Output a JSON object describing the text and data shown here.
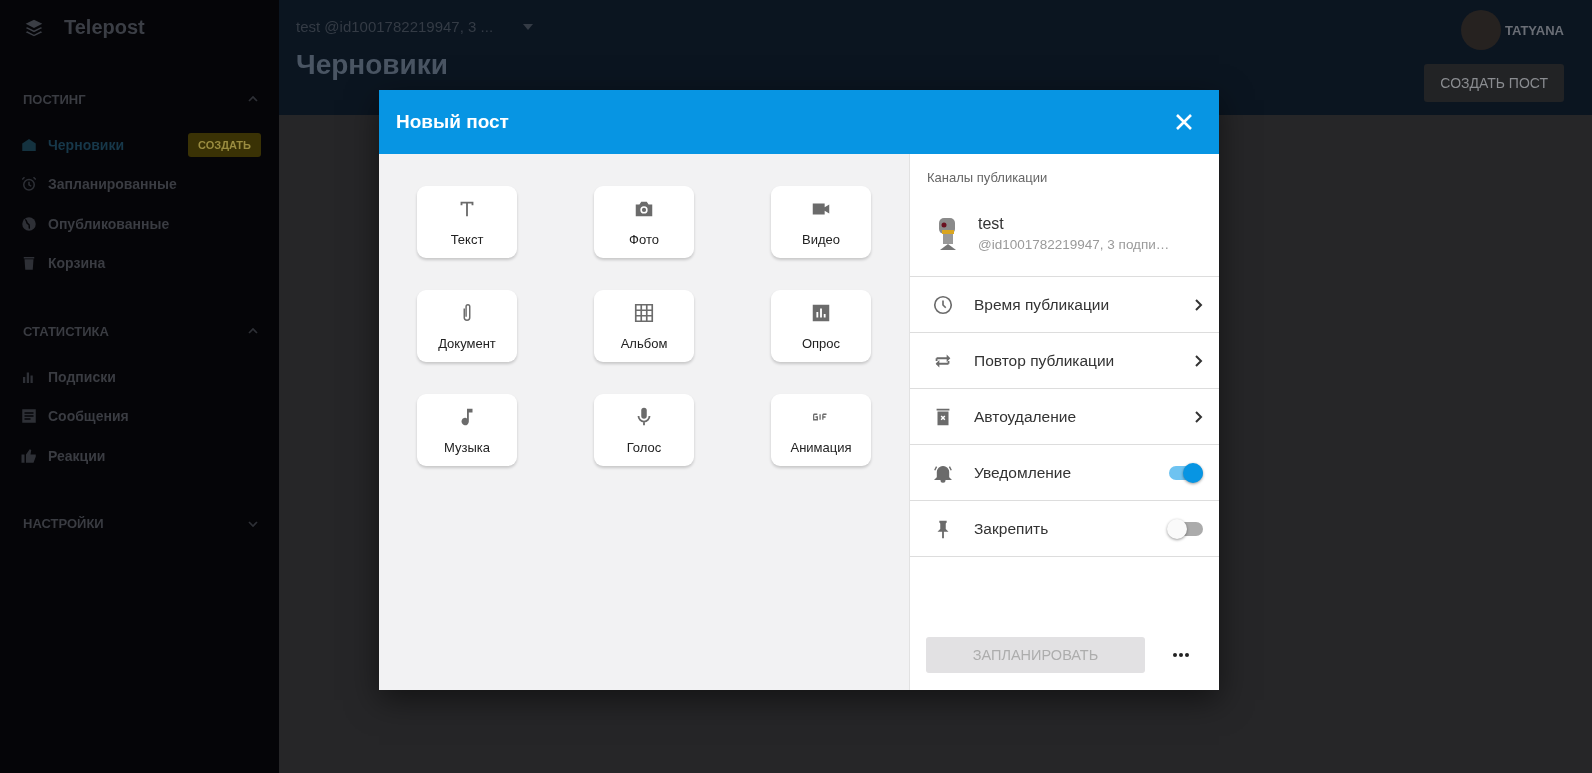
{
  "app": {
    "logo": "Telepost"
  },
  "sidebar": {
    "sections": [
      {
        "title": "ПОСТИНГ",
        "expanded": true,
        "items": [
          {
            "label": "Черновики",
            "selected": true,
            "badge": "СОЗДАТЬ"
          },
          {
            "label": "Запланированные",
            "selected": false
          },
          {
            "label": "Опубликованные",
            "selected": false
          },
          {
            "label": "Корзина",
            "selected": false
          }
        ]
      },
      {
        "title": "СТАТИСТИКА",
        "expanded": true,
        "items": [
          {
            "label": "Подписки",
            "selected": false
          },
          {
            "label": "Сообщения",
            "selected": false
          },
          {
            "label": "Реакции",
            "selected": false
          }
        ]
      },
      {
        "title": "НАСТРОЙКИ",
        "expanded": false
      }
    ]
  },
  "topbar": {
    "account": "test @id1001782219947, 3 ...",
    "user": "TATYANA",
    "page_title": "Черновики",
    "create_button": "СОЗДАТЬ ПОСТ"
  },
  "modal": {
    "title": "Новый пост",
    "post_types": [
      "Текст",
      "Фото",
      "Видео",
      "Документ",
      "Альбом",
      "Опрос",
      "Музыка",
      "Голос",
      "Анимация"
    ],
    "channels_label": "Каналы публикации",
    "channel": {
      "name": "test",
      "info": "@id1001782219947, 3 подпи…"
    },
    "options": [
      {
        "kind": "link",
        "label": "Время публикации"
      },
      {
        "kind": "link",
        "label": "Повтор публикации"
      },
      {
        "kind": "link",
        "label": "Автоудаление"
      },
      {
        "kind": "toggle",
        "label": "Уведомление",
        "on": true
      },
      {
        "kind": "toggle",
        "label": "Закрепить",
        "on": false
      }
    ],
    "schedule_button": {
      "label": "ЗАПЛАНИРОВАТЬ",
      "disabled": true
    }
  }
}
